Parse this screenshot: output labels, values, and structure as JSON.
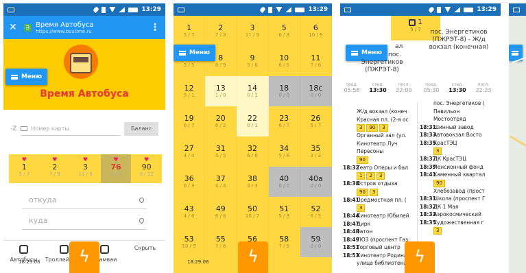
{
  "status": {
    "time": "13:29"
  },
  "phone1": {
    "browser": {
      "title": "Время Автобуса",
      "url": "https://www.bustime.ru"
    },
    "menu_label": "Меню",
    "app_title": "Время Автобуса",
    "card": {
      "prefix": "-Z",
      "placeholder": "Номер карты",
      "balance_label": "Баланс"
    },
    "favorites": [
      {
        "num": "1",
        "sub": "5 / 7"
      },
      {
        "num": "2",
        "sub": "7 / 9"
      },
      {
        "num": "3",
        "sub": "11 / 9"
      },
      {
        "num": "76",
        "sub": "0 / 0"
      },
      {
        "num": "90",
        "sub": "9 / 12"
      }
    ],
    "from_placeholder": "откуда",
    "to_placeholder": "куда",
    "tabs": [
      "Автобусы",
      "Троллейбусы",
      "Трамваи",
      "Скрыть"
    ],
    "clock": "18:29:08"
  },
  "phone2": {
    "menu_label": "Меню",
    "routes": [
      {
        "n": "1",
        "s": "5 / 7"
      },
      {
        "n": "2",
        "s": "7 / 9"
      },
      {
        "n": "3",
        "s": "11 / 9"
      },
      {
        "n": "5",
        "s": "6 / 8"
      },
      {
        "n": "6",
        "s": "10 / 9"
      },
      {
        "n": "7",
        "s": "3 / 5"
      },
      {
        "n": "8",
        "s": "8 / 9"
      },
      {
        "n": "9",
        "s": "5 / 6"
      },
      {
        "n": "10",
        "s": "6 / 5"
      },
      {
        "n": "11",
        "s": "7 / 6"
      },
      {
        "n": "12",
        "s": "5 / 1"
      },
      {
        "n": "13",
        "s": "1 / 0"
      },
      {
        "n": "14",
        "s": "0 / 1"
      },
      {
        "n": "18",
        "s": "0 / 0"
      },
      {
        "n": "18с",
        "s": "0 / 0"
      },
      {
        "n": "19",
        "s": "6 / 7"
      },
      {
        "n": "20",
        "s": "6 / 2"
      },
      {
        "n": "22",
        "s": "0 / 1"
      },
      {
        "n": "23",
        "s": "6 / 7"
      },
      {
        "n": "26",
        "s": "5 / 7"
      },
      {
        "n": "27",
        "s": "4 / 4"
      },
      {
        "n": "31",
        "s": "5 / 5"
      },
      {
        "n": "32",
        "s": "6 / 6"
      },
      {
        "n": "34",
        "s": "5 / 6"
      },
      {
        "n": "35",
        "s": "3 / 2"
      },
      {
        "n": "36",
        "s": "6 / 3"
      },
      {
        "n": "37",
        "s": "4 / 4"
      },
      {
        "n": "38",
        "s": "3 / 3"
      },
      {
        "n": "40",
        "s": "0 / 0"
      },
      {
        "n": "40а",
        "s": "0 / 0"
      },
      {
        "n": "43",
        "s": "4 / 6"
      },
      {
        "n": "49",
        "s": "6 / 6"
      },
      {
        "n": "50",
        "s": "10 / 7"
      },
      {
        "n": "51",
        "s": "5 / 8"
      },
      {
        "n": "52",
        "s": "6 / 5"
      },
      {
        "n": "53",
        "s": "10 / 9"
      },
      {
        "n": "55",
        "s": "7 / 6"
      },
      {
        "n": "56",
        "s": "0 / 1"
      },
      {
        "n": "58",
        "s": "7 / 5"
      },
      {
        "n": "59",
        "s": "0 / 0"
      }
    ],
    "clock": "18:29:08"
  },
  "phone3": {
    "route": {
      "num": "1",
      "sub": "5 / 7"
    },
    "menu_label": "Меню",
    "dir_left": [
      "ал",
      "пос.",
      "Энергетиков",
      "(ПЖРЭТ-8)"
    ],
    "dir_right": [
      "пос. Энергетиков",
      "(ПЖРЭТ-8) - Ж/д",
      "вокзал (конечная)"
    ],
    "times_left": [
      {
        "lab": "пред.",
        "v": "05:58"
      },
      {
        "lab": "след.",
        "v": "13:30"
      },
      {
        "lab": "посл.",
        "v": "22:00"
      }
    ],
    "times_right": [
      {
        "lab": "пред.",
        "v": "05:30"
      },
      {
        "lab": "след.",
        "v": "13:30"
      },
      {
        "lab": "посл.",
        "v": "22:23"
      }
    ],
    "stops_left": [
      {
        "t": "",
        "name": "Ж/д вокзал (конеч"
      },
      {
        "t": "",
        "name": "Красная пл. (2-я ос"
      },
      {
        "t": "",
        "name": "",
        "chips": [
          "3",
          "90",
          "3"
        ]
      },
      {
        "t": "",
        "name": "Органный зал (ул."
      },
      {
        "t": "",
        "name": "Кинотеатр Луч"
      },
      {
        "t": "",
        "name": "Пересоны"
      },
      {
        "t": "",
        "name": "",
        "chips": [
          "90"
        ]
      },
      {
        "t": "18:32",
        "name": "Театр Оперы и бал"
      },
      {
        "t": "",
        "name": "",
        "chips": [
          "1",
          "2",
          "3"
        ]
      },
      {
        "t": "18:38",
        "name": "Остров отдыха"
      },
      {
        "t": "",
        "name": "",
        "chips": [
          "90",
          "3"
        ]
      },
      {
        "t": "18:41",
        "name": "Предмостная пл. ("
      },
      {
        "t": "",
        "name": "",
        "chips": [
          "3"
        ]
      },
      {
        "t": "18:44",
        "name": "Кинотеатр Юбилей"
      },
      {
        "t": "18:47",
        "name": "Цирк"
      },
      {
        "t": "18:48",
        "name": "Затон"
      },
      {
        "t": "18:49",
        "name": "ТЮЗ (проспект Газ"
      },
      {
        "t": "18:51",
        "name": "Торговый центр"
      },
      {
        "t": "18:53",
        "name": "Кинотеатр Родина"
      },
      {
        "t": "",
        "name": "улица библиотека"
      }
    ],
    "stops_right": [
      {
        "t": "",
        "name": "пос. Энергетиков ("
      },
      {
        "t": "",
        "name": "Павильон"
      },
      {
        "t": "",
        "name": "Мостоотряд"
      },
      {
        "t": "18:31",
        "name": "Шинный завод"
      },
      {
        "t": "18:33",
        "name": "Автовокзал Восто"
      },
      {
        "t": "18:35",
        "name": "КрасТЭЦ"
      },
      {
        "t": "",
        "name": "",
        "chips": [
          "3"
        ]
      },
      {
        "t": "18:37",
        "name": "ДК КрасТЭЦ"
      },
      {
        "t": "18:39",
        "name": "Пенсионный фонд"
      },
      {
        "t": "18:41",
        "name": "Каменный квартал"
      },
      {
        "t": "",
        "name": "",
        "chips": [
          "90"
        ]
      },
      {
        "t": "",
        "name": "Хлебозавод (прост"
      },
      {
        "t": "18:31",
        "name": "Школа (проспект Г"
      },
      {
        "t": "18:32",
        "name": "ДК 1 Мая"
      },
      {
        "t": "18:33",
        "name": "Аэрокосмический"
      },
      {
        "t": "18:35",
        "name": "Художественная г"
      },
      {
        "t": "",
        "name": "",
        "chips": [
          "3"
        ]
      }
    ]
  },
  "colors": {
    "primary": "#2196f3",
    "status": "#1b6fb8",
    "yellow": "#ffd740",
    "orange": "#ff9800",
    "red": "#e53935"
  }
}
